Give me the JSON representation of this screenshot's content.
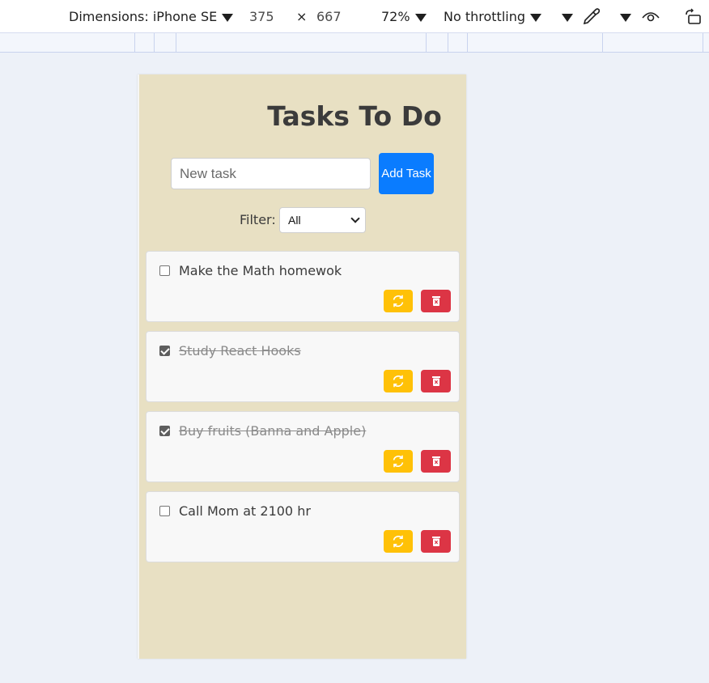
{
  "devtools": {
    "dimensions_label": "Dimensions: iPhone SE",
    "width": "375",
    "times": "×",
    "height": "667",
    "zoom": "72%",
    "throttling": "No throttling"
  },
  "app": {
    "title": "Tasks To Do",
    "input_placeholder": "New task",
    "add_button_label": "Add Task",
    "filter_label": "Filter:",
    "filter_selected": "All"
  },
  "tasks": [
    {
      "text": "Make the Math homewok",
      "completed": false
    },
    {
      "text": "Study React Hooks",
      "completed": true
    },
    {
      "text": "Buy fruits (Banna and Apple)",
      "completed": true
    },
    {
      "text": "Call Mom at 2100 hr",
      "completed": false
    }
  ],
  "colors": {
    "device_bg": "#e8e0c3",
    "add_button": "#0a7cff",
    "refresh_button": "#ffc107",
    "delete_button": "#dc3545"
  },
  "icons": {
    "refresh": "refresh-icon",
    "delete": "trash-icon"
  }
}
